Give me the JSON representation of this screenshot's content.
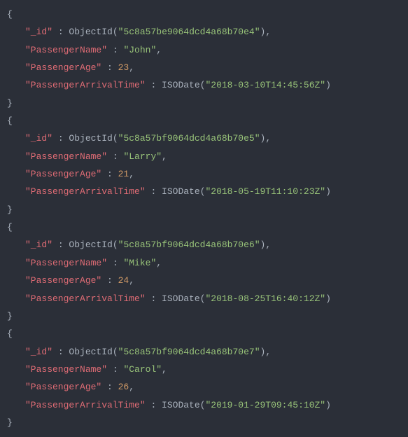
{
  "records": [
    {
      "idKey": "\"_id\"",
      "idFunc": "ObjectId",
      "idVal": "\"5c8a57be9064dcd4a68b70e4\"",
      "nameKey": "\"PassengerName\"",
      "nameVal": "\"John\"",
      "ageKey": "\"PassengerAge\"",
      "ageVal": "23",
      "timeKey": "\"PassengerArrivalTime\"",
      "timeFunc": "ISODate",
      "timeVal": "\"2018-03-10T14:45:56Z\""
    },
    {
      "idKey": "\"_id\"",
      "idFunc": "ObjectId",
      "idVal": "\"5c8a57bf9064dcd4a68b70e5\"",
      "nameKey": "\"PassengerName\"",
      "nameVal": "\"Larry\"",
      "ageKey": "\"PassengerAge\"",
      "ageVal": "21",
      "timeKey": "\"PassengerArrivalTime\"",
      "timeFunc": "ISODate",
      "timeVal": "\"2018-05-19T11:10:23Z\""
    },
    {
      "idKey": "\"_id\"",
      "idFunc": "ObjectId",
      "idVal": "\"5c8a57bf9064dcd4a68b70e6\"",
      "nameKey": "\"PassengerName\"",
      "nameVal": "\"Mike\"",
      "ageKey": "\"PassengerAge\"",
      "ageVal": "24",
      "timeKey": "\"PassengerArrivalTime\"",
      "timeFunc": "ISODate",
      "timeVal": "\"2018-08-25T16:40:12Z\""
    },
    {
      "idKey": "\"_id\"",
      "idFunc": "ObjectId",
      "idVal": "\"5c8a57bf9064dcd4a68b70e7\"",
      "nameKey": "\"PassengerName\"",
      "nameVal": "\"Carol\"",
      "ageKey": "\"PassengerAge\"",
      "ageVal": "26",
      "timeKey": "\"PassengerArrivalTime\"",
      "timeFunc": "ISODate",
      "timeVal": "\"2019-01-29T09:45:10Z\""
    }
  ],
  "punct": {
    "openBrace": "{",
    "closeBrace": "}",
    "colon": " : ",
    "comma": ",",
    "openParen": "(",
    "closeParen": ")"
  }
}
